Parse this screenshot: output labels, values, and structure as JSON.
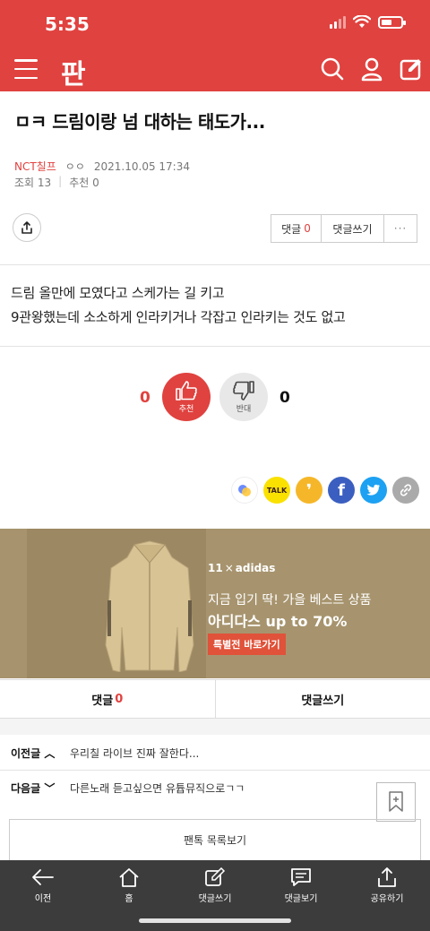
{
  "status": {
    "time": "5:35"
  },
  "header": {
    "logo": "판"
  },
  "post": {
    "title": "ㅁㅋ 드림이랑 넘 대하는 태도가...",
    "author": "NCT칠프",
    "nickname": "ㅇㅇ",
    "datetime": "2021.10.05 17:34",
    "views": "조회 13",
    "recommend": "추천 0",
    "content_lines": [
      "드림 올만에 모였다고 스케가는 길 키고",
      "9관왕했는데 소소하게 인라키거나 각잡고 인라키는 것도 없고"
    ]
  },
  "actions": {
    "comment_label": "댓글",
    "comment_count": "0",
    "write_comment": "댓글쓰기",
    "more": "···"
  },
  "vote": {
    "up_count": "0",
    "up_label": "추천",
    "down_count": "0",
    "down_label": "반대"
  },
  "share": [
    {
      "icon": "band-icon"
    },
    {
      "icon": "kakaotalk-icon",
      "text": "TALK"
    },
    {
      "icon": "kakaostory-icon"
    },
    {
      "icon": "facebook-icon",
      "text": "f"
    },
    {
      "icon": "twitter-icon"
    },
    {
      "icon": "link-icon"
    }
  ],
  "ad": {
    "brand_11st": "11",
    "brand_x": "×",
    "brand_adidas": "adidas",
    "line1": "지금 입기 딱! 가을 베스트 상품",
    "line2": "아디다스 up to 70%",
    "button": "특별전 바로가기"
  },
  "comment_bar": {
    "comment_label": "댓글",
    "comment_count": "0",
    "write": "댓글쓰기"
  },
  "prev_next": {
    "prev_label": "이전글",
    "prev_title": "우리칠 라이브 진짜 잘한다...",
    "next_label": "다음글",
    "next_title": "다른노래 듣고싶으면 유튭뮤직으로ㄱㄱ"
  },
  "list_button": "팬톡 목록보기",
  "tabbar": [
    "이전",
    "홈",
    "댓글쓰기",
    "댓글보기",
    "공유하기"
  ],
  "colors": {
    "brand_red": "#e0423f",
    "ad_bg": "#a7946e",
    "tabbar_bg": "#3c3c3c"
  }
}
